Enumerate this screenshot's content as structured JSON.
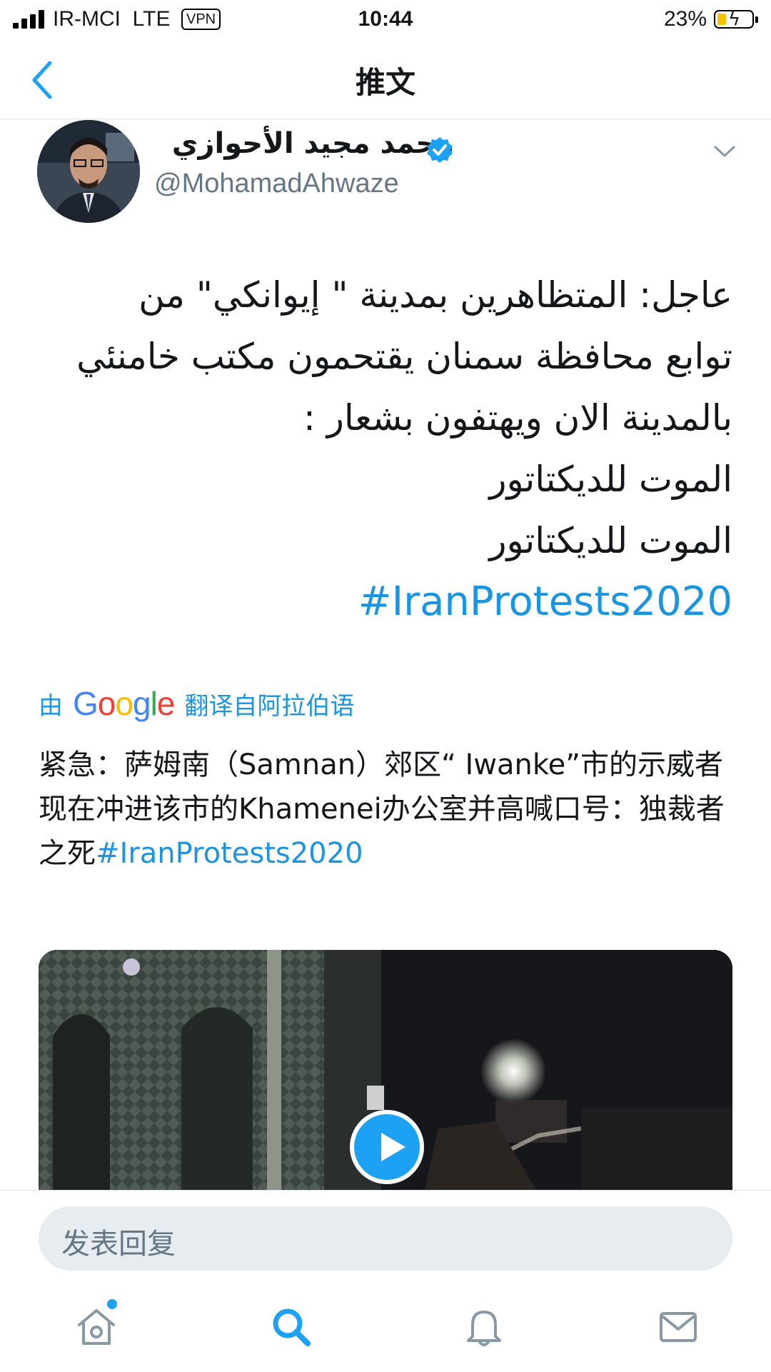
{
  "status_bar": {
    "carrier": "IR-MCI",
    "network": "LTE",
    "vpn_label": "VPN",
    "time": "10:44",
    "battery_percent": "23%"
  },
  "nav": {
    "title": "推文"
  },
  "tweet": {
    "author_name": "محمد مجيد الأحوازي",
    "author_handle": "@MohamadAhwaze",
    "verified": true,
    "text_lines": [
      "عاجل: المتظاهرين بمدينة \" إيوانكي\" من",
      "توابع محافظة سمنان يقتحمون مكتب خامنئي",
      "بالمدينة الان ويهتفون بشعار :",
      "الموت للديكتاتور",
      "الموت للديكتاتور"
    ],
    "hashtag": "#IranProtests2020",
    "translation_by_prefix": "由",
    "translation_by_logo": "Google",
    "translation_from": "翻译自阿拉伯语",
    "translation_text": "紧急：萨姆南（Samnan）郊区“ Iwanke”市的示威者现在冲进该市的Khamenei办公室并高喊口号：独裁者之死",
    "translation_hashtag": "#IranProtests2020"
  },
  "reply_box": {
    "placeholder": "发表回复"
  },
  "tab_bar": {
    "items": [
      "home-icon",
      "search-icon",
      "notifications-icon",
      "messages-icon"
    ],
    "active": "search-icon",
    "home_has_badge": true
  },
  "colors": {
    "accent": "#1da1f2",
    "link": "#1b95e0",
    "secondary_text": "#657786"
  }
}
